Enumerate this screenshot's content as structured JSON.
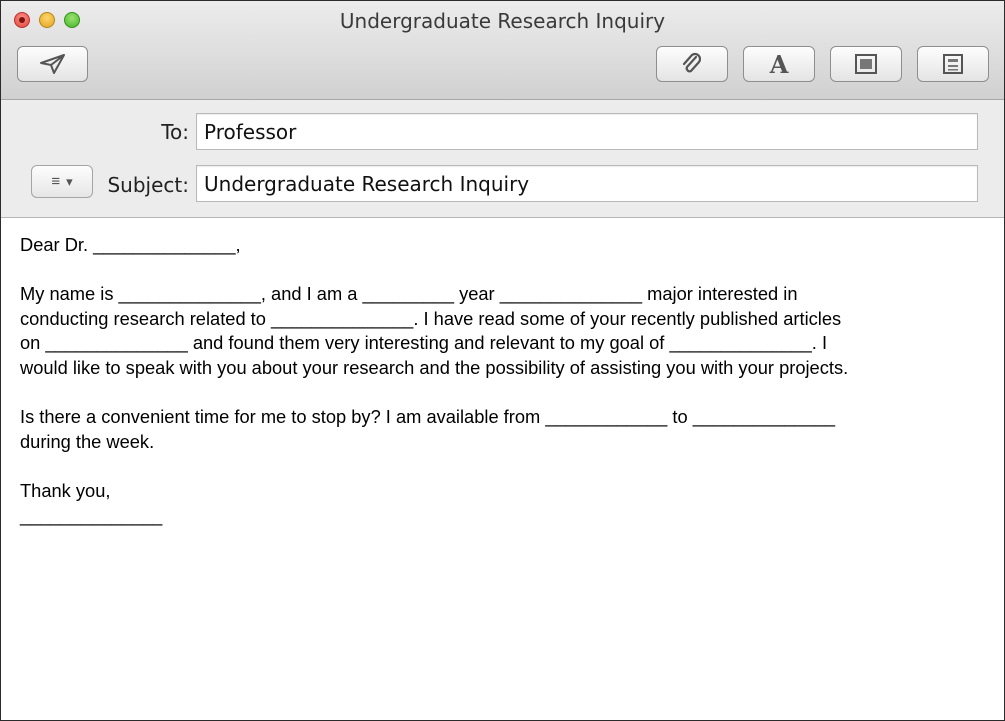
{
  "window": {
    "title": "Undergraduate Research Inquiry"
  },
  "toolbar": {
    "send_icon": "paper-plane-icon",
    "attach_icon": "paperclip-icon",
    "fonts_icon": "font-A-icon",
    "photo_icon": "photo-browser-icon",
    "stationery_icon": "stationery-icon"
  },
  "header": {
    "to_label": "To:",
    "to_value": "Professor",
    "subject_label": "Subject:",
    "subject_value": "Undergraduate Research Inquiry",
    "menu_glyph": "≡",
    "menu_arrow": "▾"
  },
  "body": {
    "greeting": "Dear Dr. ______________,",
    "para1": [
      "My name is ______________, and I am a _________ year ______________ major interested in",
      "conducting research related to ______________. I have read some of your recently published articles",
      "on ______________ and found them very interesting and relevant to my goal of ______________. I",
      "would like to speak with you about your research and the possibility of assisting you with your projects."
    ],
    "para2": [
      "Is there a convenient time for me to stop by? I am available from ____________ to ______________",
      "during the week."
    ],
    "closing": "Thank you,",
    "signature": "______________"
  },
  "colors": {
    "close": "#e0443b",
    "minimize": "#e0a420",
    "zoom": "#45b32a"
  }
}
